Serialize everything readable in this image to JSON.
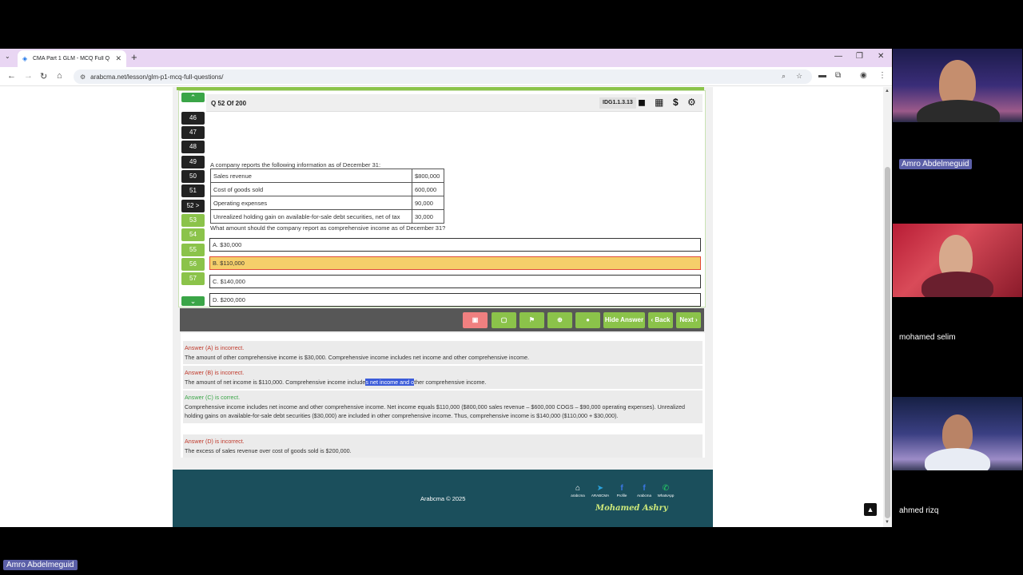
{
  "browser": {
    "tab_title": "CMA Part 1 GLM - MCQ Full Q",
    "url": "arabcma.net/lesson/glm-p1-mcq-full-questions/"
  },
  "quiz": {
    "header": "Q 52 Of 200",
    "question_id": "IDG1.1.3.13",
    "question_numbers": [
      "46",
      "47",
      "48",
      "49",
      "50",
      "51",
      "52 >",
      "53",
      "54",
      "55",
      "56",
      "57"
    ],
    "intro": "A company reports the following information as of December 31:",
    "table": [
      {
        "label": "Sales revenue",
        "value": "$800,000"
      },
      {
        "label": "Cost of goods sold",
        "value": "600,000"
      },
      {
        "label": "Operating expenses",
        "value": "90,000"
      },
      {
        "label": "Unrealized holding gain on available-for-sale debt securities, net of tax",
        "value": "30,000"
      }
    ],
    "question": "What amount should the company report as comprehensive income as of December 31?",
    "options": [
      "A. $30,000",
      "B. $110,000",
      "C. $140,000",
      "D. $200,000"
    ],
    "selected_option": "B"
  },
  "actions": {
    "hide_answer": "Hide Answer",
    "back": "‹ Back",
    "next": "Next ›"
  },
  "answers": {
    "a_head": "Answer (A) is incorrect.",
    "a_text": "The amount of other comprehensive income is $30,000. Comprehensive income includes net income and other comprehensive income.",
    "b_head": "Answer (B) is incorrect.",
    "b_text_1": "The amount of net income is $110,000. Comprehensive income include",
    "b_text_hl": "s net income and o",
    "b_text_2": "ther comprehensive income.",
    "c_head": "Answer (C) is correct.",
    "c_text": "Comprehensive income includes net income and other comprehensive income. Net income equals $110,000 ($800,000 sales revenue – $600,000 COGS – $90,000 operating expenses). Unrealized holding gains on available-for-sale debt securities ($30,000) are included in other comprehensive income. Thus, comprehensive income is $140,000 ($110,000 + $30,000).",
    "d_head": "Answer (D) is incorrect.",
    "d_text": "The excess of sales revenue over cost of goods sold is $200,000."
  },
  "footer": {
    "copyright": "Arabcma © 2025",
    "social": [
      {
        "label": "arabcma",
        "icon": "home-icon"
      },
      {
        "label": "ARABCMA",
        "icon": "telegram-icon"
      },
      {
        "label": "Profile",
        "icon": "facebook-icon"
      },
      {
        "label": "Arabcma",
        "icon": "facebook-icon"
      },
      {
        "label": "WhatsApp",
        "icon": "whatsapp-icon"
      }
    ],
    "signature": "Mohamed Ashry"
  },
  "participants": [
    {
      "name": "Amro Abdelmeguid"
    },
    {
      "name": "mohamed selim"
    },
    {
      "name": "ahmed rizq"
    }
  ],
  "active_speaker": "Amro Abdelmeguid"
}
